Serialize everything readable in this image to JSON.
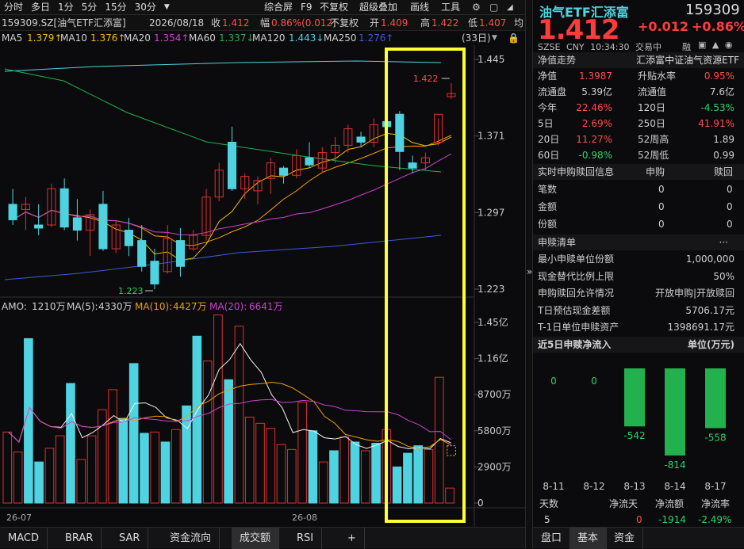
{
  "tabs": [
    "分时",
    "多日",
    "1分",
    "5分",
    "15分",
    "30分"
  ],
  "tabs_right": [
    "综合屏",
    "F9",
    "不复权",
    "超级叠加",
    "画线",
    "工具"
  ],
  "tabs_right_icon": "gear-icon",
  "header": {
    "code": "159309.SZ[油气ETF汇添富]",
    "date": "2026/08/18",
    "close_label": "收",
    "close": "1.412",
    "chg_label": "幅",
    "chg": "0.86%(0.012)",
    "adj": "不复权",
    "open_label": "开",
    "open": "1.409",
    "high_label": "高",
    "high": "1.422",
    "low_label": "低",
    "low": "1.407",
    "avg_label": "均"
  },
  "ma": {
    "ma5_label": "MA5",
    "ma5": "1.379↑",
    "ma10_label": "MA10",
    "ma10": "1.376↑",
    "ma20_label": "MA20",
    "ma20": "1.354↑",
    "ma60_label": "MA60",
    "ma60": "1.337↓",
    "ma120_label": "MA120",
    "ma120": "1.443↓",
    "ma250_label": "MA250",
    "ma250": "1.276↑",
    "period": "(33日)"
  },
  "colors": {
    "ma5": "#f5f5f5",
    "ma10": "#f0c000",
    "ma20": "#d040d0",
    "ma60": "#22b14c",
    "ma120": "#4fd3e0",
    "ma250": "#3d5bdb",
    "up": "#e03030",
    "down": "#4fd3e0",
    "highlight": "#ffff33"
  },
  "chart_data": {
    "type": "candlestick",
    "dates": [
      "26-07",
      "26-08"
    ],
    "price_ticks": [
      "1.445",
      "1.371",
      "1.297",
      "1.223"
    ],
    "vol_ticks": [
      "1.45亿",
      "1.16亿",
      "8700万",
      "5800万",
      "2900万",
      "0"
    ],
    "max_label": "1.422",
    "min_label": "1.223",
    "candles": [
      {
        "o": 1.305,
        "h": 1.32,
        "l": 1.285,
        "c": 1.29
      },
      {
        "o": 1.3,
        "h": 1.312,
        "l": 1.28,
        "c": 1.305
      },
      {
        "o": 1.285,
        "h": 1.305,
        "l": 1.275,
        "c": 1.282
      },
      {
        "o": 1.285,
        "h": 1.325,
        "l": 1.283,
        "c": 1.32
      },
      {
        "o": 1.32,
        "h": 1.33,
        "l": 1.28,
        "c": 1.283
      },
      {
        "o": 1.292,
        "h": 1.31,
        "l": 1.27,
        "c": 1.28
      },
      {
        "o": 1.28,
        "h": 1.3,
        "l": 1.255,
        "c": 1.295
      },
      {
        "o": 1.305,
        "h": 1.318,
        "l": 1.26,
        "c": 1.262
      },
      {
        "o": 1.262,
        "h": 1.29,
        "l": 1.258,
        "c": 1.285
      },
      {
        "o": 1.28,
        "h": 1.292,
        "l": 1.255,
        "c": 1.265
      },
      {
        "o": 1.27,
        "h": 1.285,
        "l": 1.24,
        "c": 1.245
      },
      {
        "o": 1.25,
        "h": 1.262,
        "l": 1.223,
        "c": 1.228
      },
      {
        "o": 1.24,
        "h": 1.285,
        "l": 1.238,
        "c": 1.272
      },
      {
        "o": 1.27,
        "h": 1.282,
        "l": 1.235,
        "c": 1.245
      },
      {
        "o": 1.262,
        "h": 1.28,
        "l": 1.26,
        "c": 1.275
      },
      {
        "o": 1.275,
        "h": 1.32,
        "l": 1.27,
        "c": 1.312
      },
      {
        "o": 1.312,
        "h": 1.345,
        "l": 1.308,
        "c": 1.338
      },
      {
        "o": 1.365,
        "h": 1.38,
        "l": 1.318,
        "c": 1.32
      },
      {
        "o": 1.32,
        "h": 1.335,
        "l": 1.31,
        "c": 1.332
      },
      {
        "o": 1.318,
        "h": 1.332,
        "l": 1.305,
        "c": 1.328
      },
      {
        "o": 1.33,
        "h": 1.35,
        "l": 1.315,
        "c": 1.345
      },
      {
        "o": 1.34,
        "h": 1.342,
        "l": 1.325,
        "c": 1.333
      },
      {
        "o": 1.333,
        "h": 1.358,
        "l": 1.33,
        "c": 1.352
      },
      {
        "o": 1.35,
        "h": 1.365,
        "l": 1.34,
        "c": 1.343
      },
      {
        "o": 1.34,
        "h": 1.36,
        "l": 1.335,
        "c": 1.355
      },
      {
        "o": 1.355,
        "h": 1.37,
        "l": 1.345,
        "c": 1.362
      },
      {
        "o": 1.362,
        "h": 1.382,
        "l": 1.355,
        "c": 1.378
      },
      {
        "o": 1.37,
        "h": 1.375,
        "l": 1.36,
        "c": 1.365
      },
      {
        "o": 1.365,
        "h": 1.388,
        "l": 1.36,
        "c": 1.382
      },
      {
        "o": 1.385,
        "h": 1.405,
        "l": 1.38,
        "c": 1.38
      },
      {
        "o": 1.392,
        "h": 1.395,
        "l": 1.338,
        "c": 1.356
      },
      {
        "o": 1.345,
        "h": 1.352,
        "l": 1.335,
        "c": 1.34
      },
      {
        "o": 1.345,
        "h": 1.355,
        "l": 1.338,
        "c": 1.35
      },
      {
        "o": 1.365,
        "h": 1.388,
        "l": 1.362,
        "c": 1.392
      },
      {
        "o": 1.409,
        "h": 1.422,
        "l": 1.407,
        "c": 1.412
      }
    ],
    "volumes": [
      5700,
      4100,
      13200,
      3300,
      4400,
      5400,
      9600,
      3500,
      5400,
      7500,
      9100,
      6800,
      11200,
      5600,
      5700,
      4900,
      5900,
      7800,
      13400,
      11400,
      15100,
      9900,
      14200,
      6900,
      6400,
      6000,
      4700,
      4300,
      8100,
      5800,
      3300,
      4200,
      5300,
      4900,
      4200,
      4800,
      5900,
      2900,
      4000,
      4600,
      4300,
      10100,
      1200
    ],
    "amo": {
      "label": "AMO:",
      "value": "1210万",
      "ma5_label": "MA(5):",
      "ma5": "4330万",
      "ma10_label": "MA(10):",
      "ma10": "4427万",
      "ma20_label": "MA(20):",
      "ma20": "6641万"
    }
  },
  "right": {
    "title": "油气ETF汇添富",
    "code": "159309",
    "price": "1.412",
    "chg": "+0.012",
    "pct": "+0.86%",
    "market": "SZSE",
    "currency": "CNY",
    "time": "10:34:30",
    "status": "交易中",
    "rong": "融",
    "nav_title": "净值走势",
    "nav_name": "汇添富中证油气资源ETF",
    "stats": [
      [
        "净值",
        "1.3987",
        "升贴水率",
        "0.95%"
      ],
      [
        "流通盘",
        "5.39亿",
        "流通值",
        "7.6亿"
      ],
      [
        "今年",
        "22.46%",
        "120日",
        "-4.53%"
      ],
      [
        "5日",
        "2.69%",
        "250日",
        "41.91%"
      ],
      [
        "20日",
        "11.27%",
        "52周高",
        "1.89"
      ],
      [
        "60日",
        "-0.98%",
        "52周低",
        "0.99"
      ]
    ],
    "rt_title": "实时申购赎回信息",
    "rt_col1": "申购",
    "rt_col2": "赎回",
    "rt_rows": [
      [
        "笔数",
        "0",
        "0"
      ],
      [
        "金额",
        "0",
        "0"
      ],
      [
        "份额",
        "0",
        "0"
      ]
    ],
    "list_title": "申赎清单",
    "list_more": "···",
    "list_rows": [
      [
        "最小申赎单位份额",
        "1,000,000"
      ],
      [
        "现金替代比例上限",
        "50%"
      ],
      [
        "申购赎回允许情况",
        "开放申购|开放赎回"
      ],
      [
        "T日预估现金差额",
        "5706.17元"
      ],
      [
        "T-1日单位申赎资产",
        "1398691.17元"
      ]
    ],
    "flow_title": "近5日申赎净流入",
    "flow_unit": "单位(万元)",
    "flow": [
      {
        "date": "8-11",
        "value": 0
      },
      {
        "date": "8-12",
        "value": 0
      },
      {
        "date": "8-13",
        "value": -542
      },
      {
        "date": "8-14",
        "value": -814
      },
      {
        "date": "8-17",
        "value": -558
      }
    ],
    "summary_headers": [
      "天数",
      "净流天",
      "净流额",
      "净流率"
    ],
    "summary_values": [
      "5",
      "0",
      "-1914",
      "-2.49%"
    ]
  },
  "bottom_tabs": [
    "MACD",
    "BRAR",
    "SAR",
    "资金流向",
    "成交额",
    "RSI",
    "+"
  ],
  "right_tabs": [
    "盘口",
    "基本",
    "资金"
  ]
}
